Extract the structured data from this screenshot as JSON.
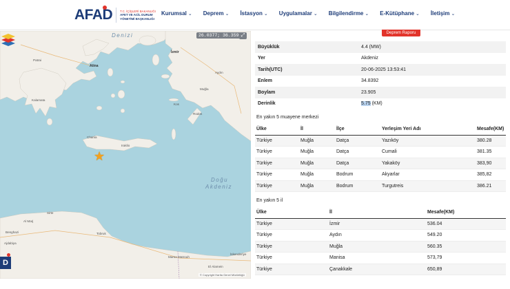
{
  "header": {
    "logo_text": "AFAD",
    "logo_sub_small": "T.C. İÇİŞLERİ BAKANLIĞI",
    "logo_sub_line1": "AFET VE ACİL DURUM",
    "logo_sub_line2": "YÖNETİMİ BAŞKANLIĞI",
    "nav": [
      "Kurumsal",
      "Deprem",
      "İstasyon",
      "Uygulamalar",
      "Bilgilendirme",
      "E-Kütüphane",
      "İletişim"
    ]
  },
  "map": {
    "coordinates": "26.0377; 36.3599",
    "copyright": "© Copyright Harita Genel Müdürlüğü",
    "labels": {
      "denizi": "Denizi",
      "dogu": "Doğu",
      "akdeniz": "Akdeniz",
      "athens": "Atina",
      "izmir": "İzmir",
      "kos": "Kos",
      "rodos": "Rodos",
      "iraklio": "Iraklio",
      "chania": "Chania",
      "kalamata": "Kalamata",
      "patras": "Patrai",
      "mugla": "Muğla",
      "aydin": "Aydın",
      "sirte": "Sirte",
      "benghazi": "Benghazi",
      "tobruk": "Tobruk",
      "alex": "El Alamein",
      "marsa": "Marsa Matrouh",
      "iskenderiye": "İskenderiye",
      "almarj": "Al Marj",
      "ajdabiya": "Ajdabiya"
    }
  },
  "panel": {
    "report_button": "Deprem Raporu",
    "details": [
      {
        "label": "Büyüklük",
        "value": "4.4 (MW)"
      },
      {
        "label": "Yer",
        "value": "Akdeniz"
      },
      {
        "label": "Tarih(UTC)",
        "value": "20-06-2025 13:53:41"
      },
      {
        "label": "Enlem",
        "value": "34.8392"
      },
      {
        "label": "Boylam",
        "value": "23.905"
      },
      {
        "label": "Derinlik",
        "value_num": "5.75",
        "value_unit": "(KM)"
      }
    ],
    "centers_title": "En yakın 5 muayene merkezi",
    "centers_headers": [
      "Ülke",
      "İl",
      "İlçe",
      "Yerleşim Yeri Adı",
      "Mesafe(KM)"
    ],
    "centers": [
      [
        "Türkiye",
        "Muğla",
        "Datça",
        "Yazıköy",
        "380.28"
      ],
      [
        "Türkiye",
        "Muğla",
        "Datça",
        "Cumali",
        "381.35"
      ],
      [
        "Türkiye",
        "Muğla",
        "Datça",
        "Yakaköy",
        "383,90"
      ],
      [
        "Türkiye",
        "Muğla",
        "Bodrum",
        "Akyarlar",
        "385,82"
      ],
      [
        "Türkiye",
        "Muğla",
        "Bodrum",
        "Turgutreis",
        "386.21"
      ]
    ],
    "provinces_title": "En yakın 5 il",
    "provinces_headers": [
      "Ülke",
      "İl",
      "Mesafe(KM)"
    ],
    "provinces": [
      [
        "Türkiye",
        "İzmir",
        "536.04"
      ],
      [
        "Türkiye",
        "Aydın",
        "549.20"
      ],
      [
        "Türkiye",
        "Muğla",
        "560.35"
      ],
      [
        "Türkiye",
        "Manisa",
        "573,79"
      ],
      [
        "Türkiye",
        "Çanakkale",
        "650,89"
      ]
    ]
  },
  "colors": {
    "brand": "#1d3c78",
    "accent": "#e2342b",
    "sea": "#aad3df",
    "land": "#f2efe9",
    "epicenter": "#f2a11f"
  }
}
